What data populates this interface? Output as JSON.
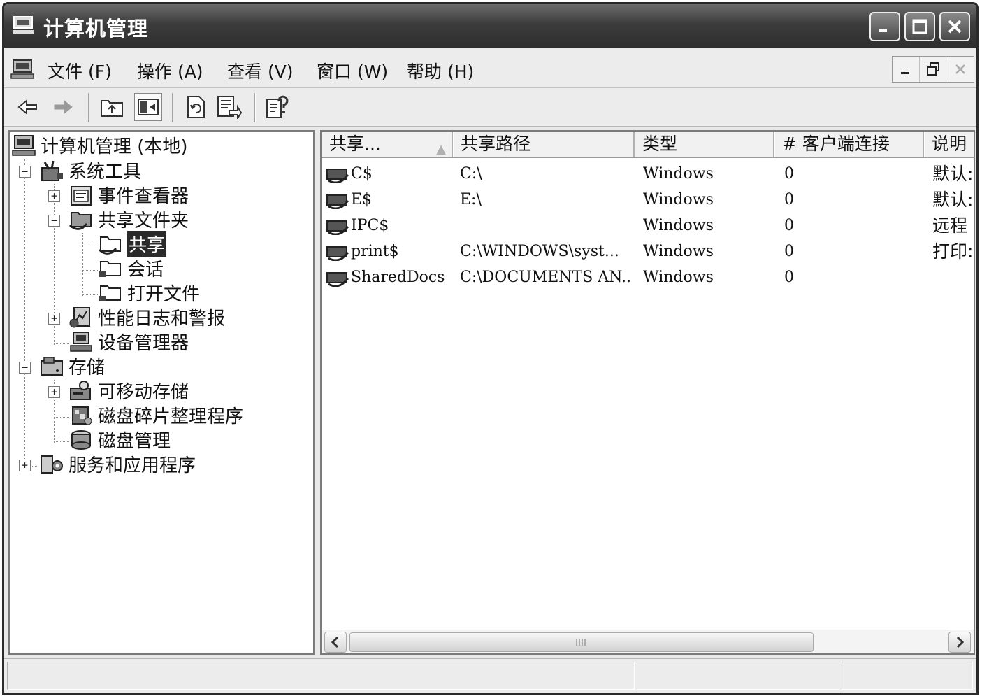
{
  "window": {
    "title": "计算机管理"
  },
  "menu": [
    {
      "label": "文件 (F)"
    },
    {
      "label": "操作 (A)"
    },
    {
      "label": "查看 (V)"
    },
    {
      "label": "窗口 (W)"
    },
    {
      "label": "帮助 (H)"
    }
  ],
  "toolbar": {
    "icons": [
      "back-icon",
      "forward-icon",
      "up-level-icon",
      "show-hide-tree-icon",
      "refresh-icon",
      "export-list-icon",
      "help-icon"
    ]
  },
  "tree": {
    "root": "计算机管理 (本地)",
    "system_tools": "系统工具",
    "event_viewer": "事件查看器",
    "shared_folders": "共享文件夹",
    "shares": "共享",
    "sessions": "会话",
    "open_files": "打开文件",
    "perf_logs": "性能日志和警报",
    "device_manager": "设备管理器",
    "storage": "存储",
    "removable_storage": "可移动存储",
    "defrag": "磁盘碎片整理程序",
    "disk_mgmt": "磁盘管理",
    "services_apps": "服务和应用程序"
  },
  "list": {
    "columns": [
      "共享...",
      "共享路径",
      "类型",
      "# 客户端连接",
      "说明"
    ],
    "sort_indicator": "▲",
    "rows": [
      {
        "name": "C$",
        "path": "C:\\",
        "type": "Windows",
        "clients": "0",
        "desc": "默认:"
      },
      {
        "name": "E$",
        "path": "E:\\",
        "type": "Windows",
        "clients": "0",
        "desc": "默认:"
      },
      {
        "name": "IPC$",
        "path": "",
        "type": "Windows",
        "clients": "0",
        "desc": "远程"
      },
      {
        "name": "print$",
        "path": "C:\\WINDOWS\\syst...",
        "type": "Windows",
        "clients": "0",
        "desc": "打印:"
      },
      {
        "name": "SharedDocs",
        "path": "C:\\DOCUMENTS AN...",
        "type": "Windows",
        "clients": "0",
        "desc": ""
      }
    ]
  },
  "status": {
    "sections": [
      "",
      "",
      ""
    ]
  }
}
